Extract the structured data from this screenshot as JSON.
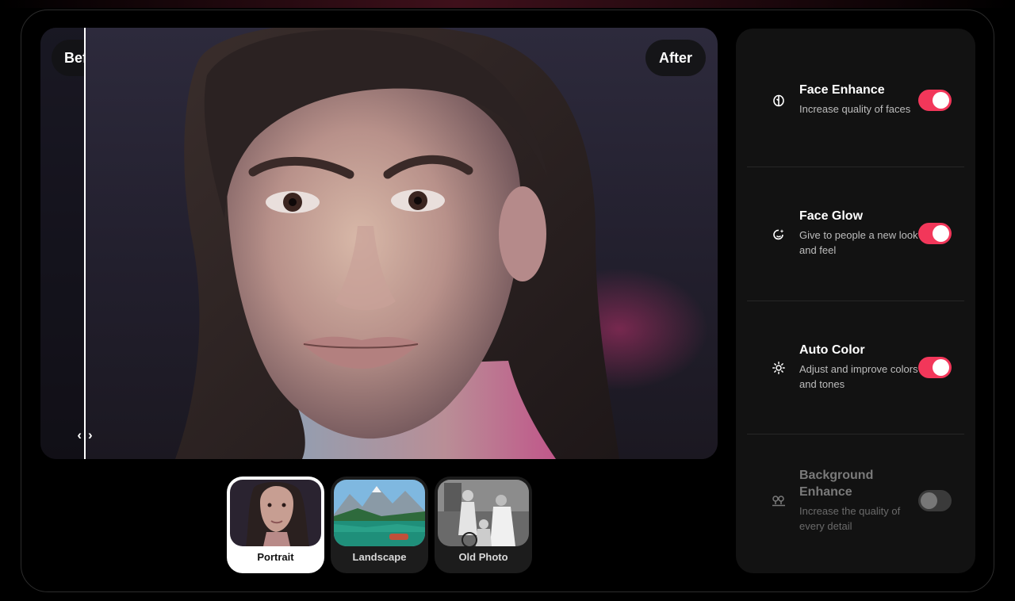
{
  "preview": {
    "before_label": "Before",
    "after_label": "After",
    "handle_left_icon": "chevron-left-icon",
    "handle_right_icon": "chevron-right-icon",
    "handle_left_glyph": "‹",
    "handle_right_glyph": "›"
  },
  "samples": [
    {
      "label": "Portrait",
      "active": true
    },
    {
      "label": "Landscape",
      "active": false
    },
    {
      "label": "Old Photo",
      "active": false
    }
  ],
  "options": [
    {
      "title": "Face Enhance",
      "description": "Increase quality of faces",
      "icon": "face-enhance-icon",
      "enabled": true
    },
    {
      "title": "Face Glow",
      "description": "Give to people a new look and feel",
      "icon": "face-glow-icon",
      "enabled": true
    },
    {
      "title": "Auto Color",
      "description": "Adjust and improve colors and tones",
      "icon": "sun-icon",
      "enabled": true
    },
    {
      "title": "Background Enhance",
      "description": "Increase the quality of every detail",
      "icon": "background-enhance-icon",
      "enabled": false
    }
  ],
  "colors": {
    "accent": "#f2375a",
    "panel": "#121212",
    "background": "#000000"
  }
}
